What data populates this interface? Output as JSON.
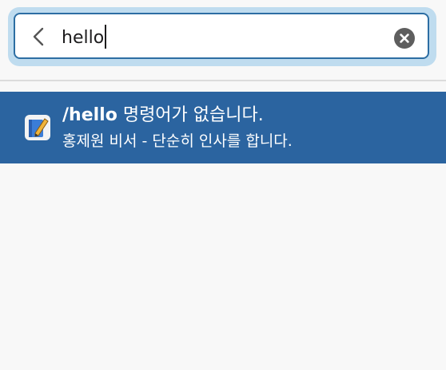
{
  "search": {
    "query": "hello"
  },
  "result": {
    "command": "/hello",
    "message": "명령어가 없습니다.",
    "description": "홍제원 비서 - 단순히 인사를 합니다."
  },
  "colors": {
    "accent": "#2d6ea3",
    "focus_ring": "#bfdcef",
    "selected_row": "#2b64a0",
    "background": "#f8f8f8"
  },
  "icons": {
    "back": "chevron-left-icon",
    "clear": "clear-circle-icon",
    "app": "notebook-pencil-icon"
  }
}
